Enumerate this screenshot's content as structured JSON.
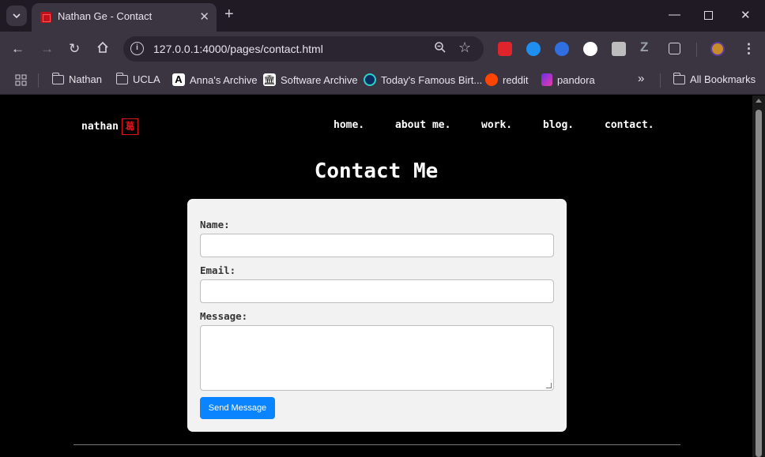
{
  "browser": {
    "tab_title": "Nathan Ge - Contact",
    "url": "127.0.0.1:4000/pages/contact.html",
    "bookmarks": [
      {
        "label": "Nathan",
        "icon": "folder-icon"
      },
      {
        "label": "UCLA",
        "icon": "folder-icon"
      },
      {
        "label": "Anna's Archive",
        "icon": "annas-archive-icon"
      },
      {
        "label": "Software Archive",
        "icon": "archive-org-icon"
      },
      {
        "label": "Today's Famous Birt...",
        "icon": "famous-birthdays-icon"
      },
      {
        "label": "reddit",
        "icon": "reddit-icon"
      },
      {
        "label": "pandora",
        "icon": "pandora-icon"
      }
    ],
    "all_bookmarks": "All Bookmarks",
    "overflow": "»"
  },
  "site": {
    "logo_text": "nathan",
    "logo_seal": "葛",
    "nav": [
      "home.",
      "about me.",
      "work.",
      "blog.",
      "contact."
    ],
    "title": "Contact Me"
  },
  "form": {
    "name_label": "Name:",
    "email_label": "Email:",
    "message_label": "Message:",
    "name_value": "",
    "email_value": "",
    "message_value": "",
    "submit_label": "Send Message"
  },
  "colors": {
    "accent": "#0a84ff",
    "logo_red": "#d8141c",
    "page_bg": "#000000",
    "card_bg": "#f2f2f2"
  }
}
